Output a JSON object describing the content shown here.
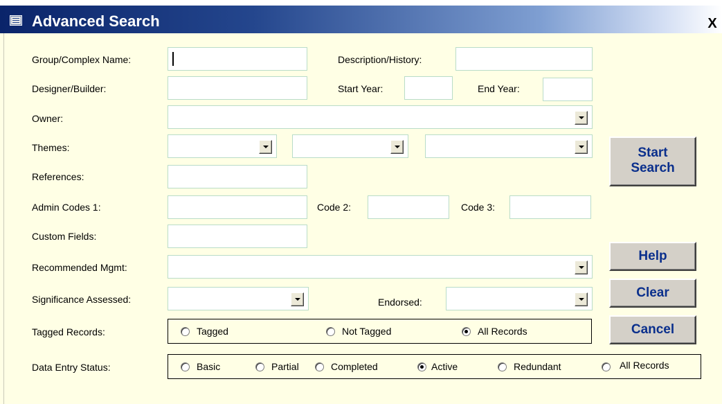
{
  "window": {
    "title": "Advanced Search",
    "close_glyph": "X"
  },
  "labels": {
    "group_complex_name": "Group/Complex Name:",
    "description_history": "Description/History:",
    "designer_builder": "Designer/Builder:",
    "start_year": "Start Year:",
    "end_year": "End Year:",
    "owner": "Owner:",
    "themes": "Themes:",
    "references": "References:",
    "admin_codes_1": "Admin Codes 1:",
    "code_2": "Code 2:",
    "code_3": "Code 3:",
    "custom_fields": "Custom Fields:",
    "recommended_mgmt": "Recommended Mgmt:",
    "significance_assessed": "Significance Assessed:",
    "endorsed": "Endorsed:",
    "tagged_records": "Tagged Records:",
    "data_entry_status": "Data Entry Status:"
  },
  "fields": {
    "group_complex_name": "",
    "description_history": "",
    "designer_builder": "",
    "start_year": "",
    "end_year": "",
    "owner": "",
    "theme_1": "",
    "theme_2": "",
    "theme_3": "",
    "references": "",
    "admin_codes_1": "",
    "code_2": "",
    "code_3": "",
    "custom_fields": "",
    "recommended_mgmt": "",
    "significance_assessed": "",
    "endorsed": ""
  },
  "buttons": {
    "start_search_line1": "Start",
    "start_search_line2": "Search",
    "help": "Help",
    "clear": "Clear",
    "cancel": "Cancel"
  },
  "tagged_records": {
    "options": [
      "Tagged",
      "Not Tagged",
      "All Records"
    ],
    "selected": "All Records"
  },
  "data_entry_status": {
    "options": [
      "Basic",
      "Partial",
      "Completed",
      "Active",
      "Redundant",
      "All Records"
    ],
    "selected": "Active"
  },
  "icons": {
    "title": "form-icon",
    "close": "close-icon",
    "dropdown": "chevron-down-icon"
  },
  "colors": {
    "form_background": "#ffffe5",
    "title_bar": "#0a246a",
    "button_text": "#0a2f8c"
  }
}
